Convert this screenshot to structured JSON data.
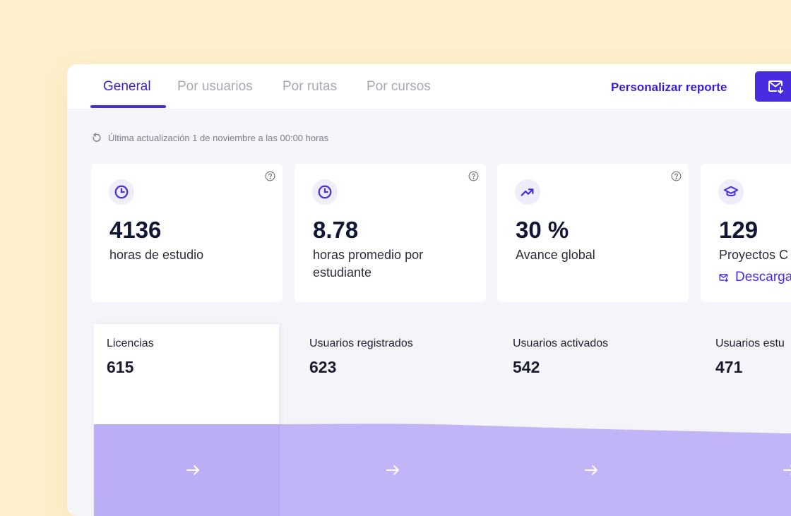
{
  "tabs": [
    {
      "label": "General",
      "active": true
    },
    {
      "label": "Por usuarios",
      "active": false
    },
    {
      "label": "Por rutas",
      "active": false
    },
    {
      "label": "Por cursos",
      "active": false
    }
  ],
  "header": {
    "personalize_label": "Personalizar reporte",
    "mail_icon": "mail-download-icon"
  },
  "update_text": "Última actualización 1 de noviembre a las 00:00 horas",
  "cards": [
    {
      "icon": "clock-icon",
      "value": "4136",
      "label": "horas de estudio",
      "help": true
    },
    {
      "icon": "clock-icon",
      "value": "8.78",
      "label": "horas promedio por estudiante",
      "help": true
    },
    {
      "icon": "trending-up-icon",
      "value": "30 %",
      "label": "Avance global",
      "help": true
    },
    {
      "icon": "graduation-cap-icon",
      "value": "129",
      "label": "Proyectos C",
      "download_label": "Descarga"
    }
  ],
  "funnel": [
    {
      "label": "Licencias",
      "value": "615"
    },
    {
      "label": "Usuarios registrados",
      "value": "623"
    },
    {
      "label": "Usuarios activados",
      "value": "542"
    },
    {
      "label": "Usuarios estu",
      "value": "471"
    }
  ],
  "colors": {
    "accent": "#4a2ce0",
    "background": "#fdefcb",
    "funnel_fill": "#c1b4f7"
  }
}
